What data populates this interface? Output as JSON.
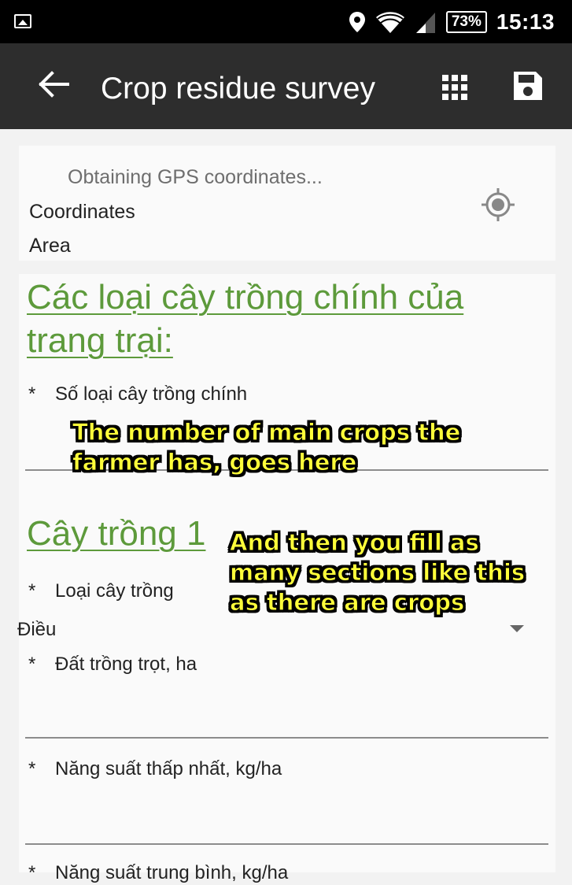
{
  "status_bar": {
    "battery": "73%",
    "time": "15:13",
    "icons": [
      "image-icon",
      "location-pin-icon",
      "wifi-icon",
      "signal-icon",
      "battery-icon"
    ]
  },
  "toolbar": {
    "title": "Crop residue survey",
    "icons": [
      "back-arrow-icon",
      "grid-menu-icon",
      "save-icon"
    ]
  },
  "gps": {
    "status": "Obtaining GPS coordinates...",
    "coordinates_label": "Coordinates",
    "area_label": "Area",
    "icon": "gps-target-icon"
  },
  "form": {
    "section_main_crops": "Các loại cây trồng chính của\ntrang trại:",
    "num_crops_label": "Số loại cây trồng chính",
    "section_crop1": "Cây trồng 1",
    "crop_type_label": "Loại cây trồng",
    "crop_type_value": "Điều",
    "cultivated_area_label": "Đất trồng trọt, ha",
    "min_yield_label": "Năng suất thấp nhất, kg/ha",
    "next_label_partial": "Năng suất trung bình, kg/ha",
    "required_marker": "*"
  },
  "annotations": {
    "note1": "The number of main crops the\nfarmer has, goes here",
    "note2": "And then you fill as\nmany sections like this\nas there are crops"
  },
  "colors": {
    "status_bar": "#000000",
    "toolbar": "#2d2d2d",
    "heading_green": "#5d9a3b",
    "annotation_yellow": "#ffff3a"
  }
}
